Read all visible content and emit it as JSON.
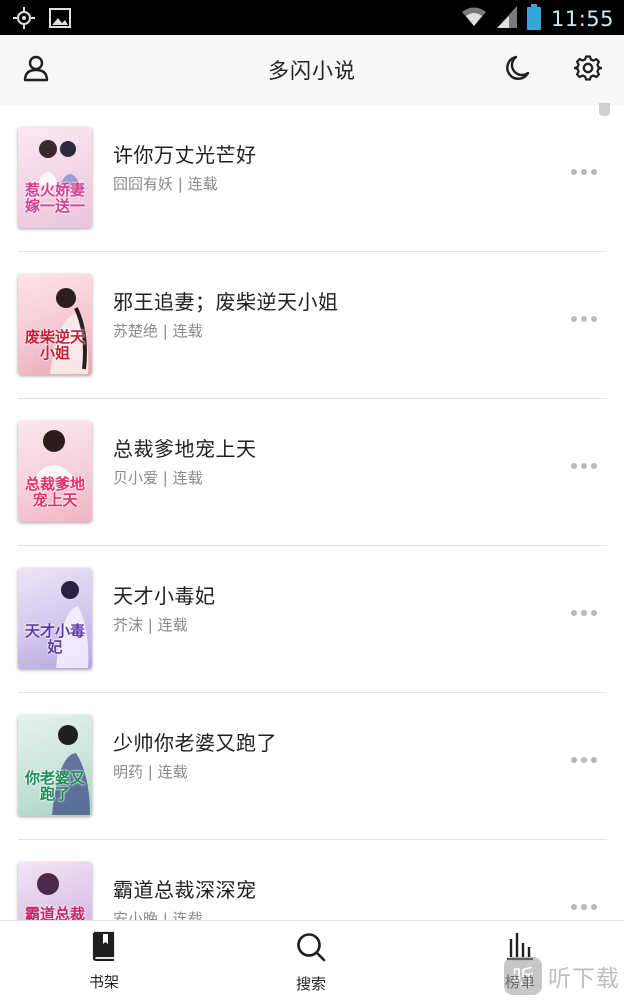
{
  "status_bar": {
    "time": "11:55",
    "icons": [
      "gps-icon",
      "image-icon",
      "wifi-icon",
      "signal-icon",
      "battery-icon"
    ]
  },
  "header": {
    "title": "多闪小说",
    "left_icon": "user-icon",
    "right_icons": [
      "night-mode-icon",
      "settings-icon"
    ]
  },
  "books": [
    {
      "title": "许你万丈光芒好",
      "author": "囧囧有妖",
      "separator": "|",
      "status": "连载",
      "cover_text": "惹火娇妻嫁一送一",
      "cover_colors": [
        "#fbe9f3",
        "#e9c5dc"
      ]
    },
    {
      "title": "邪王追妻；废柴逆天小姐",
      "author": "苏楚绝",
      "separator": "|",
      "status": "连载",
      "cover_text": "废柴逆天小姐",
      "cover_colors": [
        "#fde4e8",
        "#e8a8b6"
      ]
    },
    {
      "title": "总裁爹地宠上天",
      "author": "贝小爱",
      "separator": "|",
      "status": "连载",
      "cover_text": "总裁爹地宠上天",
      "cover_colors": [
        "#fbe8ee",
        "#efb4c5"
      ]
    },
    {
      "title": "天才小毒妃",
      "author": "芥沫",
      "separator": "|",
      "status": "连载",
      "cover_text": "天才小毒妃",
      "cover_colors": [
        "#ece6f7",
        "#b7a6dd"
      ]
    },
    {
      "title": "少帅你老婆又跑了",
      "author": "明药",
      "separator": "|",
      "status": "连载",
      "cover_text": "你老婆又跑了",
      "cover_colors": [
        "#e6f2ee",
        "#a9d2c4"
      ]
    },
    {
      "title": "霸道总裁深深宠",
      "author": "安小晚",
      "separator": "|",
      "status": "连载",
      "cover_text": "霸道总裁",
      "cover_colors": [
        "#f1e6f6",
        "#c8a4d8"
      ]
    }
  ],
  "bottom_nav": [
    {
      "label": "书架",
      "icon": "bookshelf-icon"
    },
    {
      "label": "搜索",
      "icon": "search-icon"
    },
    {
      "label": "榜单",
      "icon": "ranking-icon"
    }
  ],
  "watermark": {
    "badge": "听",
    "text": "听下载"
  },
  "colors": {
    "accent": "#222222",
    "muted_text": "#8a8a8a",
    "divider": "#e3e3e3",
    "header_bg": "#f7f7f7"
  }
}
